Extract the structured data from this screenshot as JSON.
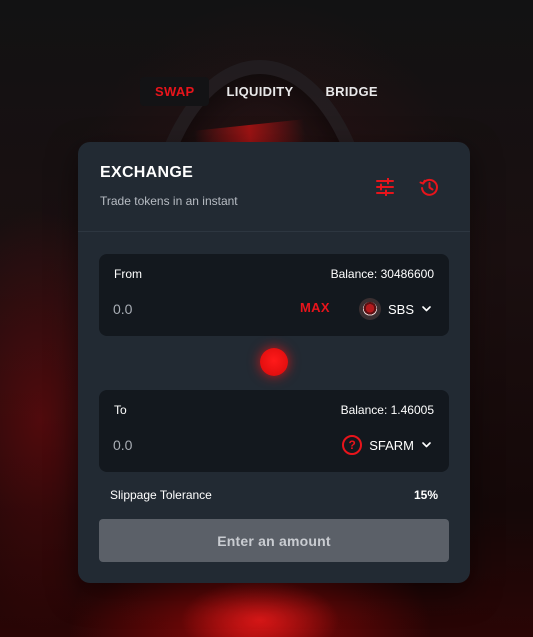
{
  "nav": {
    "tabs": [
      {
        "label": "SWAP",
        "active": true
      },
      {
        "label": "LIQUIDITY",
        "active": false
      },
      {
        "label": "BRIDGE",
        "active": false
      }
    ]
  },
  "exchange": {
    "title": "EXCHANGE",
    "subtitle": "Trade tokens in an instant",
    "icons": [
      "settings-sliders-icon",
      "history-icon"
    ]
  },
  "from": {
    "label": "From",
    "balance": "Balance: 30486600",
    "amount_placeholder": "0.0",
    "max_label": "MAX",
    "token": "SBS",
    "token_icon": "sbs-token-logo"
  },
  "to": {
    "label": "To",
    "balance": "Balance: 1.46005",
    "amount_placeholder": "0.0",
    "token": "SFARM",
    "token_icon": "question-circle-icon"
  },
  "slippage": {
    "label": "Slippage Tolerance",
    "value": "15%"
  },
  "submit": {
    "label": "Enter an amount"
  },
  "colors": {
    "accent": "#e8141b",
    "card": "#222a33",
    "panel": "#13181e",
    "button_disabled": "#5b6068"
  }
}
